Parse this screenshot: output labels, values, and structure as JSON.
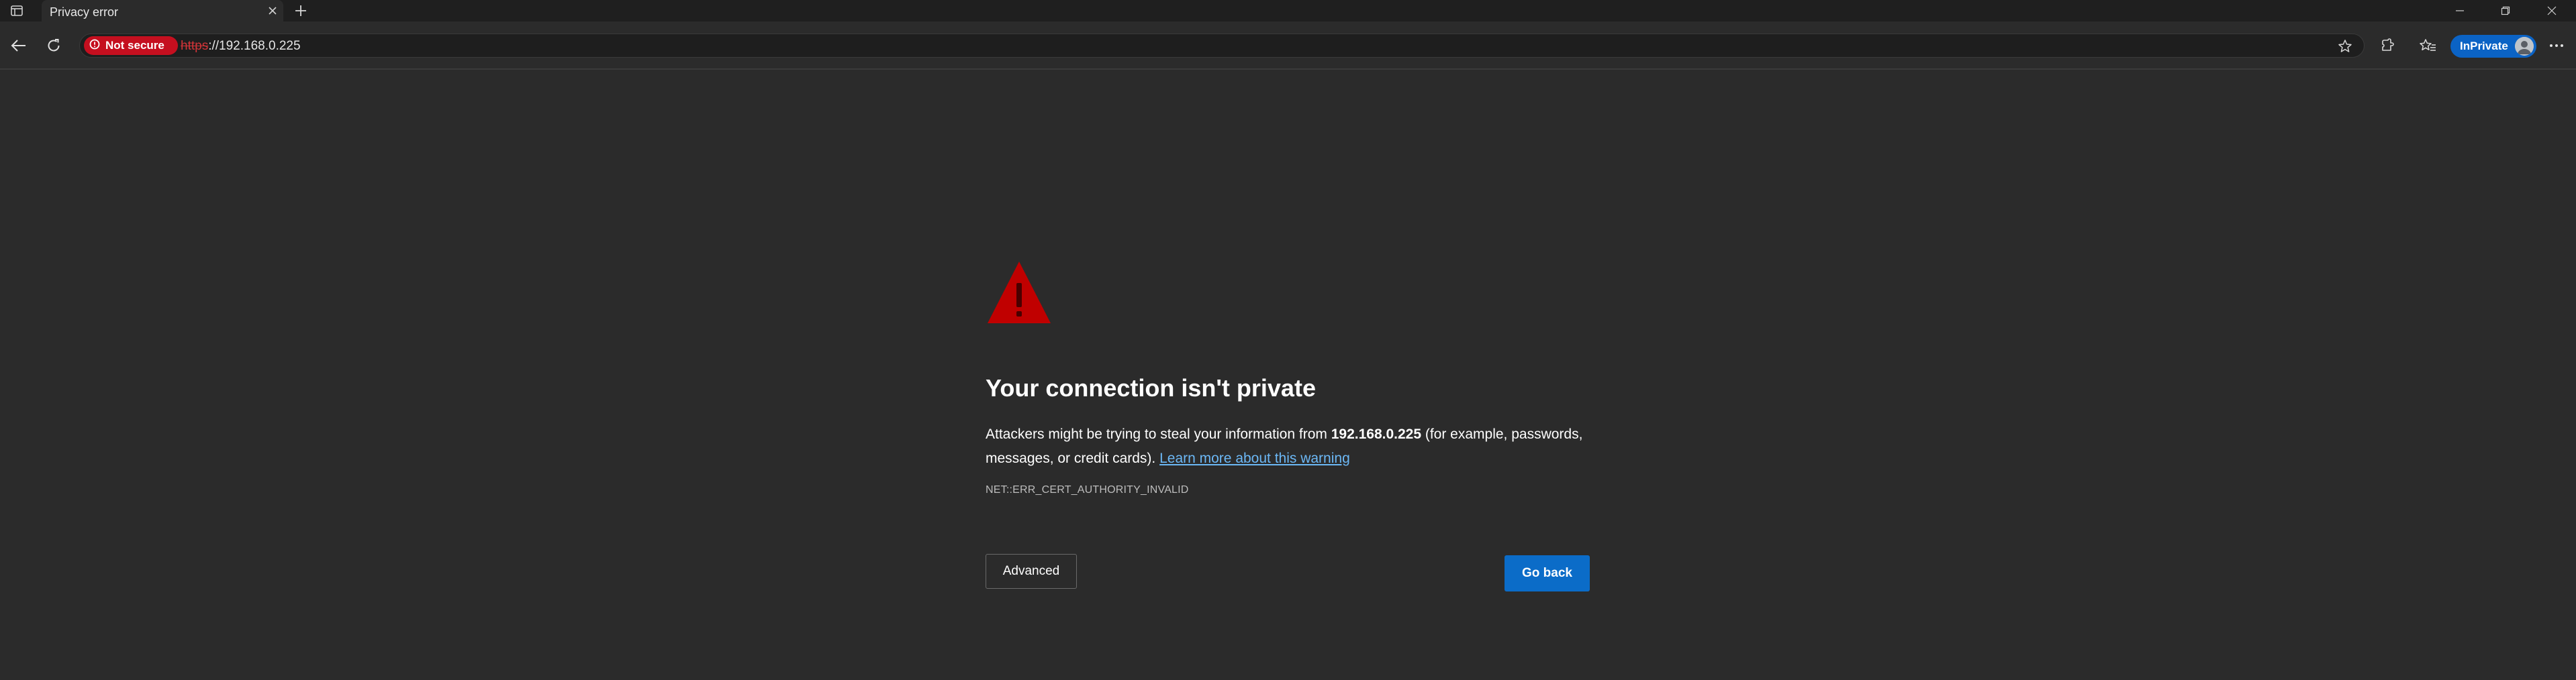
{
  "tabstrip": {
    "tab_title": "Privacy error"
  },
  "toolbar": {
    "security_badge": "Not secure",
    "url_scheme": "https",
    "url_rest": "://192.168.0.225",
    "inprivate_label": "InPrivate"
  },
  "page": {
    "heading": "Your connection isn't private",
    "body_before_host": "Attackers might be trying to steal your information from ",
    "host": "192.168.0.225",
    "body_after_host": " (for example, passwords, messages, or credit cards). ",
    "learn_more_link": "Learn more about this warning",
    "error_code": "NET::ERR_CERT_AUTHORITY_INVALID",
    "advanced_button": "Advanced",
    "go_back_button": "Go back"
  },
  "icons": {
    "tab_actions": "tab-actions-icon",
    "tab_close": "close-icon",
    "new_tab": "plus-icon",
    "back": "arrow-left-icon",
    "refresh": "refresh-icon",
    "not_secure": "warning-circle-icon",
    "favorite": "star-icon",
    "extensions": "extensions-icon",
    "favorites": "favorites-icon",
    "more": "more-icon",
    "warning": "warning-triangle-icon"
  },
  "colors": {
    "page_background": "#2b2b2b",
    "not_secure_badge": "#c50f1f",
    "warning_triangle": "#c00000",
    "primary_button": "#0b6cc8",
    "link": "#6cb8f6",
    "inprivate_pill": "#0b63c5"
  }
}
